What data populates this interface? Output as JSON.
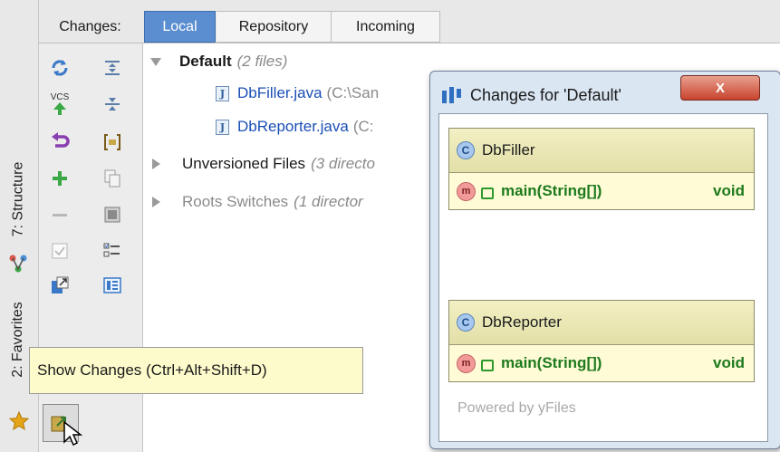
{
  "left_strip": {
    "structure_label": "7: Structure",
    "favorites_label": "2: Favorites"
  },
  "tabs": {
    "changes_label": "Changes:",
    "local_label": "Local",
    "repository_label": "Repository",
    "incoming_label": "Incoming"
  },
  "tree": {
    "default_name": "Default",
    "default_count": "(2 files)",
    "file1_name": "DbFiller.java",
    "file1_path": "(C:\\San",
    "file2_name": "DbReporter.java",
    "file2_path": "(C:",
    "unversioned_name": "Unversioned Files",
    "unversioned_count": "(3 directo",
    "roots_name": "Roots Switches",
    "roots_count": "(1 director"
  },
  "popup": {
    "title": "Changes for 'Default'",
    "close_label": "X",
    "class1_name": "DbFiller",
    "class1_method": "main(String[])",
    "class1_return": "void",
    "class2_name": "DbReporter",
    "class2_method": "main(String[])",
    "class2_return": "void",
    "footer": "Powered by yFiles"
  },
  "tooltip": {
    "text": "Show Changes (Ctrl+Alt+Shift+D)"
  },
  "toolbar": {
    "vcs_label": "VCS"
  },
  "colors": {
    "accent_tab": "#5a8ed0",
    "class_green": "#1d7a1d",
    "file_blue": "#1a4fb5"
  }
}
